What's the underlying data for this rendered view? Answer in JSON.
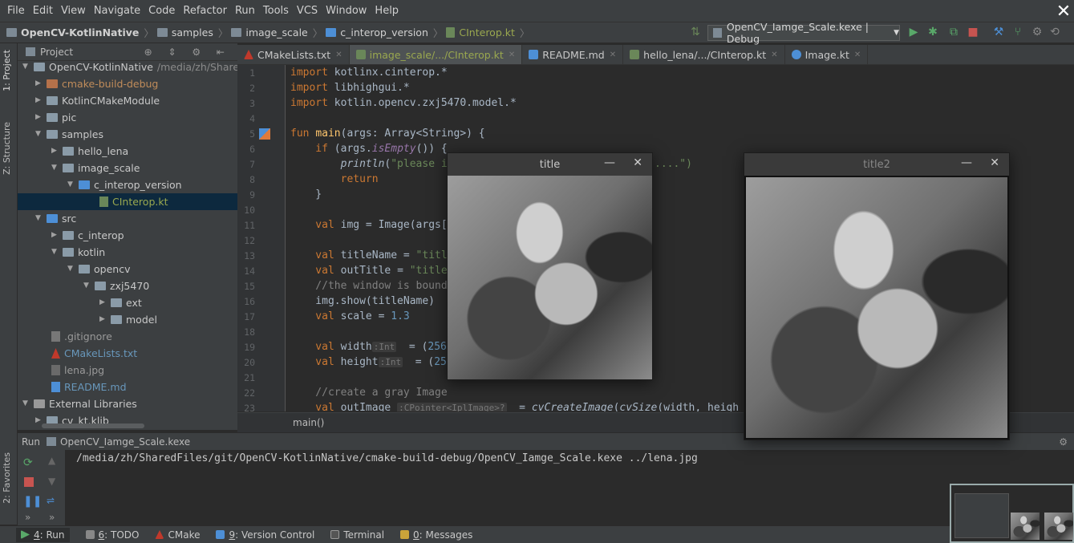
{
  "menu": [
    "File",
    "Edit",
    "View",
    "Navigate",
    "Code",
    "Refactor",
    "Run",
    "Tools",
    "VCS",
    "Window",
    "Help"
  ],
  "breadcrumbs": [
    "OpenCV-KotlinNative",
    "samples",
    "image_scale",
    "c_interop_version",
    "CInterop.kt"
  ],
  "run_config": "OpenCV_Iamge_Scale.kexe | Debug",
  "left_tabs": {
    "project": "1: Project",
    "structure": "Z: Structure",
    "favorites": "2: Favorites"
  },
  "project_header": "Project",
  "tree": [
    {
      "label": "OpenCV-KotlinNative",
      "path": "/media/zh/SharedF"
    },
    {
      "label": "cmake-build-debug"
    },
    {
      "label": "KotlinCMakeModule"
    },
    {
      "label": "pic"
    },
    {
      "label": "samples"
    },
    {
      "label": "hello_lena"
    },
    {
      "label": "image_scale"
    },
    {
      "label": "c_interop_version"
    },
    {
      "label": "CInterop.kt"
    },
    {
      "label": "src"
    },
    {
      "label": "c_interop"
    },
    {
      "label": "kotlin"
    },
    {
      "label": "opencv"
    },
    {
      "label": "zxj5470"
    },
    {
      "label": "ext"
    },
    {
      "label": "model"
    },
    {
      "label": ".gitignore"
    },
    {
      "label": "CMakeLists.txt"
    },
    {
      "label": "lena.jpg"
    },
    {
      "label": "README.md"
    },
    {
      "label": "External Libraries"
    },
    {
      "label": "cv_kt.klib"
    }
  ],
  "tabs": [
    "CMakeLists.txt",
    "image_scale/.../CInterop.kt",
    "README.md",
    "hello_lena/.../CInterop.kt",
    "Image.kt"
  ],
  "line_numbers": [
    "1",
    "2",
    "3",
    "4",
    "5",
    "6",
    "7",
    "8",
    "9",
    "10",
    "11",
    "12",
    "13",
    "14",
    "15",
    "16",
    "17",
    "18",
    "19",
    "20",
    "21",
    "22",
    "23"
  ],
  "code": {
    "l1a": "import",
    "l1b": " kotlinx.cinterop.*",
    "l2a": "import",
    "l2b": " libhighgui.*",
    "l3a": "import",
    "l3b": " kotlin.opencv.zxj5470.model.*",
    "l5a": "fun",
    "l5b": "main",
    "l5c": "(args: Array<String>) {",
    "l6a": "    if",
    "l6b": " (args.",
    "l6c": "isEmpty",
    "l6d": "()) {",
    "l7a": "        println",
    "l7b": "(",
    "l7c": "\"please i",
    "l7d": "....\")",
    "l8a": "        return",
    "l9a": "    }",
    "l11a": "    val",
    "l11b": " img = Image(args[",
    "l13a": "    val",
    "l13b": " titleName = ",
    "l13c": "\"titl",
    "l14a": "    val",
    "l14b": " outTitle = ",
    "l14c": "\"title",
    "l15a": "    //the window is bound",
    "l16a": "    img.show(titleName)",
    "l17a": "    val",
    "l17b": " scale = ",
    "l17c": "1.3",
    "l19a": "    val",
    "l19b": " width",
    "l19h": ":Int",
    "l19c": "  = (",
    "l19d": "256",
    "l20a": "    val",
    "l20b": " height",
    "l20h": ":Int",
    "l20c": "  = (",
    "l20d": "25",
    "l22a": "    //create a gray Image",
    "l23a": "    val",
    "l23b": " outImage ",
    "l23h": ":CPointer<IplImage>?",
    "l23c": "  = ",
    "l23d": "cvCreateImage",
    "l23e": "(",
    "l23f": "cvSize",
    "l23g": "(width, heigh"
  },
  "code_breadcrumb": "main()",
  "run_panel": {
    "label": "Run",
    "config": "OpenCV_Iamge_Scale.kexe"
  },
  "console_line": "/media/zh/SharedFiles/git/OpenCV-KotlinNative/cmake-build-debug/OpenCV_Iamge_Scale.kexe ../lena.jpg",
  "status": [
    {
      "mn": "4",
      "label": ": Run"
    },
    {
      "mn": "6",
      "label": ": TODO"
    },
    {
      "mn": "",
      "label": "CMake"
    },
    {
      "mn": "9",
      "label": ": Version Control"
    },
    {
      "mn": "",
      "label": "Terminal"
    },
    {
      "mn": "0",
      "label": ": Messages"
    }
  ],
  "window1": {
    "title": "title",
    "min": "—",
    "close": "✕"
  },
  "window2": {
    "title": "title2",
    "min": "—",
    "close": "✕"
  },
  "colors": {
    "keyword": "#cc7832",
    "string": "#6a8759",
    "number": "#6897bb",
    "function": "#ffc66d",
    "selection": "#0d293e"
  }
}
